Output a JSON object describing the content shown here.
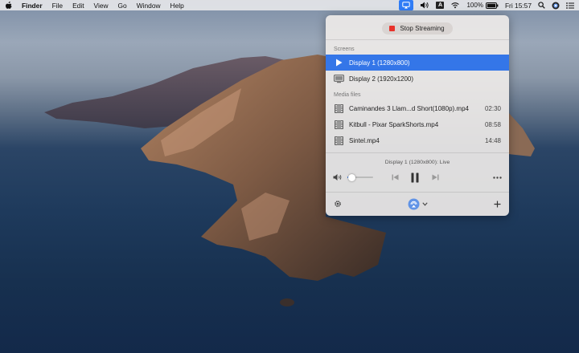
{
  "menubar": {
    "app_name": "Finder",
    "menus": [
      "File",
      "Edit",
      "View",
      "Go",
      "Window",
      "Help"
    ],
    "battery_percent": "100%",
    "clock": "Fri 15:57",
    "icons": [
      "apple-icon",
      "airplay-status-icon",
      "volume-icon",
      "input-source-icon",
      "wifi-icon",
      "battery-icon",
      "search-icon",
      "user-icon",
      "control-list-icon"
    ],
    "input_source_letter": "A"
  },
  "popover": {
    "stop_button_label": "Stop Streaming",
    "screens_label": "Screens",
    "screens": [
      {
        "label": "Display 1 (1280x800)",
        "icon": "play-icon",
        "selected": true
      },
      {
        "label": "Display 2 (1920x1200)",
        "icon": "monitor-icon",
        "selected": false
      }
    ],
    "media_label": "Media files",
    "media": [
      {
        "label": "Caminandes 3  Llam...d Short(1080p).mp4",
        "duration": "02:30",
        "icon": "film-icon"
      },
      {
        "label": "Kitbull - Pixar SparkShorts.mp4",
        "duration": "08:58",
        "icon": "film-icon"
      },
      {
        "label": "Sintel.mp4",
        "duration": "14:48",
        "icon": "film-icon"
      }
    ],
    "status": "Display 1 (1280x800): Live",
    "volume_level": 0.05,
    "footer_icons": [
      "settings-icon",
      "airplay-device-icon",
      "chevron-down-icon",
      "plus-icon"
    ]
  },
  "colors": {
    "accent": "#3476e8",
    "stop": "#e8322a",
    "airplay_highlight": "#2f7cf6"
  }
}
